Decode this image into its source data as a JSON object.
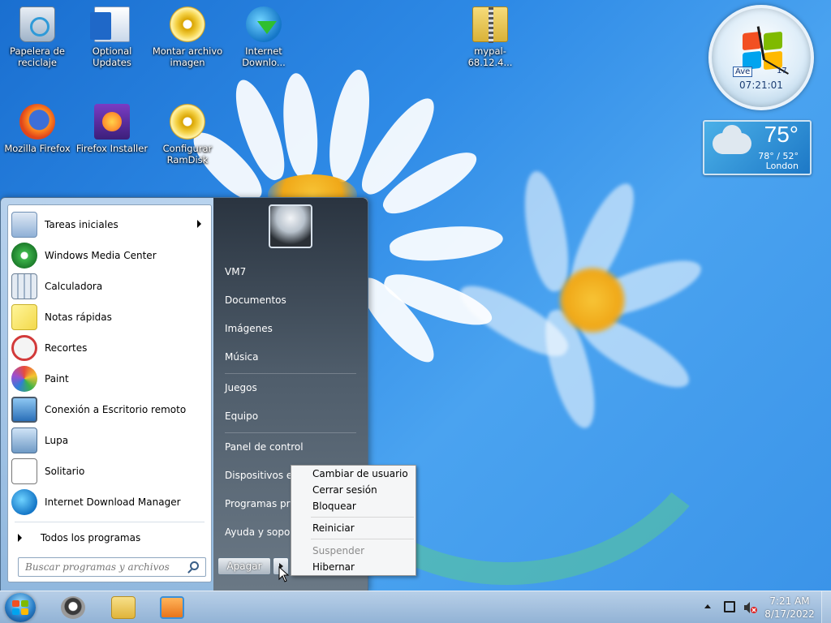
{
  "desktop": {
    "icons": [
      {
        "label": "Papelera de reciclaje",
        "icon": "recycle-bin-icon"
      },
      {
        "label": "Optional Updates",
        "icon": "document-icon"
      },
      {
        "label": "Montar archivo imagen",
        "icon": "disc-icon"
      },
      {
        "label": "Internet Downlo...",
        "icon": "internet-download-manager-icon"
      },
      {
        "label": "mypal-68.12.4...",
        "icon": "zip-folder-icon"
      },
      {
        "label": "Mozilla Firefox",
        "icon": "firefox-icon"
      },
      {
        "label": "Firefox Installer",
        "icon": "firefox-installer-icon"
      },
      {
        "label": "Configurar RamDisk",
        "icon": "disc-icon"
      }
    ]
  },
  "gadgets": {
    "clock": {
      "label": "Ave",
      "date": "17",
      "time": "07:21:01"
    },
    "weather": {
      "temp": "75°",
      "range": "78° / 52°",
      "city": "London"
    }
  },
  "start_menu": {
    "programs": [
      {
        "label": "Tareas iniciales",
        "icon": "getting-started-icon",
        "has_submenu": true
      },
      {
        "label": "Windows Media Center",
        "icon": "media-center-icon"
      },
      {
        "label": "Calculadora",
        "icon": "calculator-icon"
      },
      {
        "label": "Notas rápidas",
        "icon": "sticky-notes-icon"
      },
      {
        "label": "Recortes",
        "icon": "snipping-tool-icon"
      },
      {
        "label": "Paint",
        "icon": "paint-icon"
      },
      {
        "label": "Conexión a Escritorio remoto",
        "icon": "remote-desktop-icon"
      },
      {
        "label": "Lupa",
        "icon": "magnifier-icon"
      },
      {
        "label": "Solitario",
        "icon": "solitaire-icon"
      },
      {
        "label": "Internet Download Manager",
        "icon": "internet-download-manager-icon"
      }
    ],
    "all_programs": "Todos los programas",
    "search_placeholder": "Buscar programas y archivos",
    "right": {
      "user": "VM7",
      "items": [
        "Documentos",
        "Imágenes",
        "Música",
        "Juegos",
        "Equipo",
        "Panel de control",
        "Dispositivos e impresoras",
        "Programas predeterminados",
        "Ayuda y soporte técnico"
      ]
    },
    "shutdown_label": "Apagar"
  },
  "power_menu": {
    "items": [
      "Cambiar de usuario",
      "Cerrar sesión",
      "Bloquear",
      "Reiniciar",
      "Suspender",
      "Hibernar"
    ],
    "disabled": [
      "Suspender"
    ]
  },
  "taskbar": {
    "time": "7:21 AM",
    "date": "8/17/2022"
  }
}
